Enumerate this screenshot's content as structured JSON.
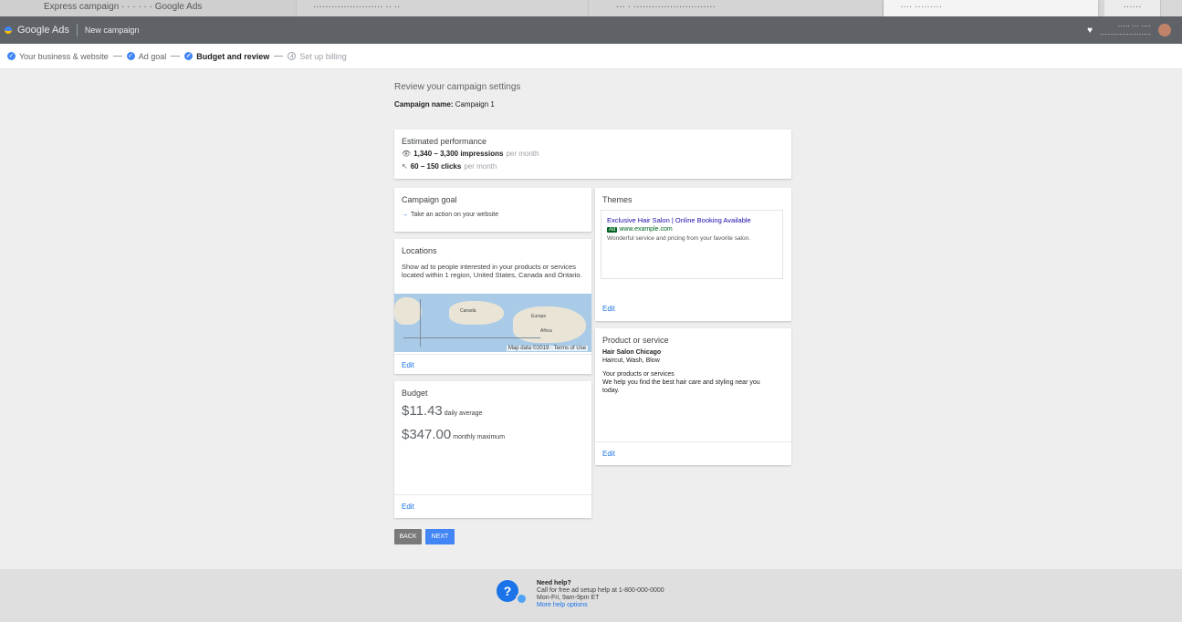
{
  "browser": {
    "tabs": [
      {
        "label": "Express campaign · · · · · · Google Ads"
      },
      {
        "label": "······················· ·· ··"
      },
      {
        "label": "··· · ···························"
      },
      {
        "label": "···· ·········"
      },
      {
        "label": "······"
      }
    ]
  },
  "appbar": {
    "brand": "Google Ads",
    "subtitle": "New campaign",
    "account_line1": "····· ··· ····",
    "account_line2": "·····················"
  },
  "steps": [
    {
      "label": "Your business & website",
      "state": "done"
    },
    {
      "label": "Ad goal",
      "state": "done"
    },
    {
      "label": "Budget and review",
      "state": "current"
    },
    {
      "label": "Set up billing",
      "state": "todo"
    }
  ],
  "page": {
    "heading": "Review your campaign settings",
    "campaign_label": "Campaign name:",
    "campaign_value": "Campaign 1"
  },
  "estimate": {
    "title": "Estimated performance",
    "row1_value": "1,340 – 3,300 impressions",
    "row1_unit": "per month",
    "row2_value": "60 – 150 clicks",
    "row2_unit": "per month"
  },
  "goal": {
    "title": "Campaign goal",
    "value": "Take an action on your website"
  },
  "locations": {
    "title": "Locations",
    "desc": "Show ad to people interested in your products or services located within 1 region, United States, Canada and Ontario.",
    "map_credit": "Map data ©2019 · Terms of Use",
    "labels": [
      "Canada",
      "Europe",
      "Africa"
    ],
    "edit": "Edit"
  },
  "budget": {
    "title": "Budget",
    "daily_amount": "$11.43",
    "daily_label": "daily average",
    "monthly_amount": "$347.00",
    "monthly_label": "monthly maximum",
    "edit": "Edit"
  },
  "themes": {
    "title": "Themes",
    "ad_headline": "Exclusive Hair Salon | Online Booking Available",
    "ad_badge": "Ad",
    "ad_url": "www.example.com",
    "ad_desc": "Wonderful service and pricing from your favorite salon.",
    "edit": "Edit"
  },
  "product": {
    "title": "Product or service",
    "name_line1": "Hair Salon Chicago",
    "name_line2": "Haircut, Wash, Blow",
    "head_line1": "Your products or services",
    "head_line2": "We help you find the best hair care and styling near you",
    "head_line3": "today.",
    "edit": "Edit"
  },
  "buttons": {
    "back": "BACK",
    "next": "NEXT"
  },
  "footer": {
    "title": "Need help?",
    "line1": "Call for free ad setup help at 1-800-000-0000",
    "line2": "Mon-Fri, 9am-9pm ET",
    "link": "More help options"
  },
  "colors": {
    "accent": "#4285f4",
    "link": "#1a73e8",
    "appbar": "#5f6368"
  }
}
